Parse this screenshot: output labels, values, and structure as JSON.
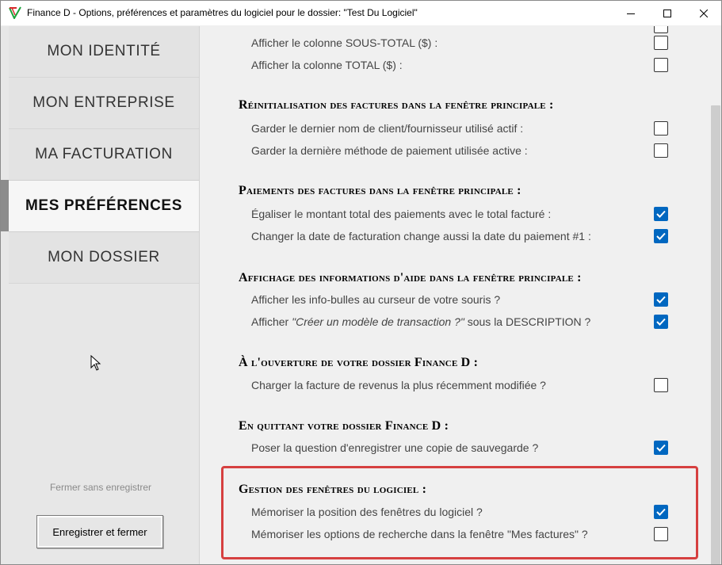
{
  "window": {
    "title": "Finance D - Options, préférences et paramètres du logiciel pour le dossier: \"Test Du Logiciel\""
  },
  "sidebar": {
    "items": [
      {
        "label": "MON IDENTITÉ"
      },
      {
        "label": "MON ENTREPRISE"
      },
      {
        "label": "MA FACTURATION"
      },
      {
        "label": "MES PRÉFÉRENCES"
      },
      {
        "label": "MON DOSSIER"
      }
    ],
    "cancel_label": "Fermer sans enregistrer",
    "save_label": "Enregistrer et fermer"
  },
  "content": {
    "top_rows": [
      {
        "label": "Afficher le colonne SOUS-TOTAL ($) :",
        "checked": false
      },
      {
        "label": "Afficher la colonne TOTAL ($) :",
        "checked": false
      }
    ],
    "sections": [
      {
        "title": "Réinitialisation des factures dans la fenêtre principale :",
        "rows": [
          {
            "label": "Garder le dernier nom de client/fournisseur utilisé actif :",
            "checked": false
          },
          {
            "label": "Garder la dernière méthode de paiement utilisée active :",
            "checked": false
          }
        ]
      },
      {
        "title": "Paiements des factures dans la fenêtre principale :",
        "rows": [
          {
            "label": "Égaliser le montant total des paiements avec le total facturé :",
            "checked": true
          },
          {
            "label": "Changer la date de facturation change aussi la date du paiement #1 :",
            "checked": true
          }
        ]
      },
      {
        "title": "Affichage des informations d'aide dans la fenêtre principale :",
        "rows": [
          {
            "label": "Afficher les info-bulles au curseur de votre souris ?",
            "checked": true
          },
          {
            "label_prefix": "Afficher ",
            "label_italic": "\"Créer un modèle de transaction ?\"",
            "label_suffix": " sous la DESCRIPTION ?",
            "checked": true
          }
        ]
      },
      {
        "title": "À l'ouverture de votre dossier Finance D :",
        "rows": [
          {
            "label": "Charger la facture de revenus la plus récemment modifiée ?",
            "checked": false
          }
        ]
      },
      {
        "title": "En quittant votre dossier Finance D :",
        "rows": [
          {
            "label": "Poser la question d'enregistrer une copie de sauvegarde ?",
            "checked": true
          }
        ]
      },
      {
        "title": "Gestion des fenêtres du logiciel :",
        "rows": [
          {
            "label": "Mémoriser la position des fenêtres du logiciel ?",
            "checked": true
          },
          {
            "label": "Mémoriser les options de recherche dans la fenêtre \"Mes factures\" ?",
            "checked": false
          }
        ]
      }
    ]
  },
  "colors": {
    "checkbox_checked": "#0067c0",
    "highlight_border": "#d64040"
  }
}
